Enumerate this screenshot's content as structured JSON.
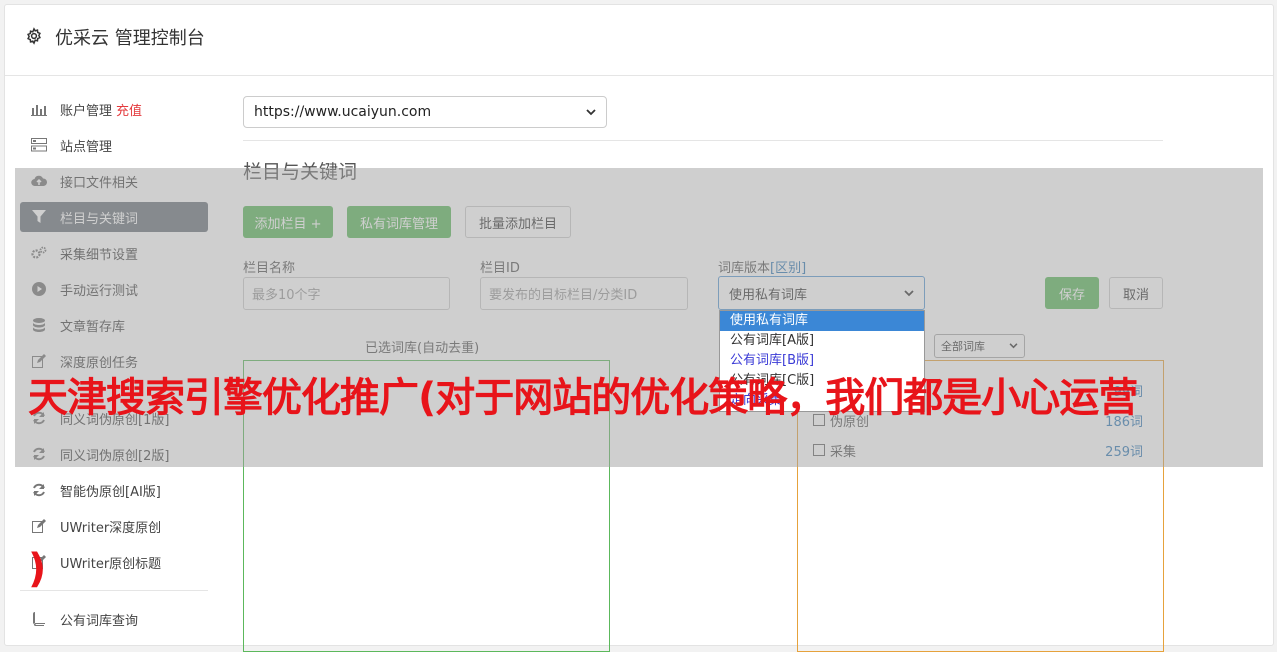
{
  "header": {
    "title": "优采云 管理控制台"
  },
  "sidebar": {
    "items": [
      {
        "label": "账户管理",
        "badge": "充值",
        "icon": "bar-chart-icon"
      },
      {
        "label": "站点管理",
        "icon": "server-icon"
      },
      {
        "label": "接口文件相关",
        "icon": "cloud-upload-icon"
      },
      {
        "label": "栏目与关键词",
        "icon": "filter-icon"
      },
      {
        "label": "采集细节设置",
        "icon": "gears-icon"
      },
      {
        "label": "手动运行测试",
        "icon": "play-circle-icon"
      },
      {
        "label": "文章暂存库",
        "icon": "database-icon"
      },
      {
        "label": "深度原创任务",
        "icon": "edit-icon"
      },
      {
        "label": "同义词伪原创[1版]",
        "icon": "refresh-icon"
      },
      {
        "label": "同义词伪原创[2版]",
        "icon": "refresh-icon"
      },
      {
        "label": "智能伪原创[AI版]",
        "icon": "refresh-icon"
      },
      {
        "label": "UWriter深度原创",
        "icon": "edit-icon"
      },
      {
        "label": "UWriter原创标题",
        "icon": "edit-icon"
      },
      {
        "label": "公有词库查询",
        "icon": "book-icon"
      }
    ]
  },
  "main": {
    "site_select": "https://www.ucaiyun.com",
    "section_title": "栏目与关键词",
    "buttons": {
      "add_column": "添加栏目 +",
      "private_lib": "私有词库管理",
      "batch_add": "批量添加栏目",
      "save": "保存",
      "cancel": "取消"
    },
    "form": {
      "name_label": "栏目名称",
      "name_placeholder": "最多10个字",
      "id_label": "栏目ID",
      "id_placeholder": "要发布的目标栏目/分类ID",
      "version_label": "词库版本",
      "version_link": "[区别]",
      "version_value": "使用私有词库",
      "version_options": [
        "使用私有词库",
        "公有词库[A版]",
        "公有词库[B版]",
        "公有词库[C版]",
        "定向采集"
      ]
    },
    "selected_title": "已选词库(自动去重)",
    "filter_select": "全部词库",
    "libraries": [
      {
        "name": "",
        "count": "99词"
      },
      {
        "name": "伪原创",
        "count": "186词"
      },
      {
        "name": "采集",
        "count": "259词"
      }
    ]
  },
  "overlay_text": "天津搜索引擎优化推广(对于网站的优化策略，我们都是小心运营",
  "overlay_text2": ")",
  "colors": {
    "green": "#5cb85c",
    "active": "#6c757d",
    "banner": "#e8141a"
  }
}
